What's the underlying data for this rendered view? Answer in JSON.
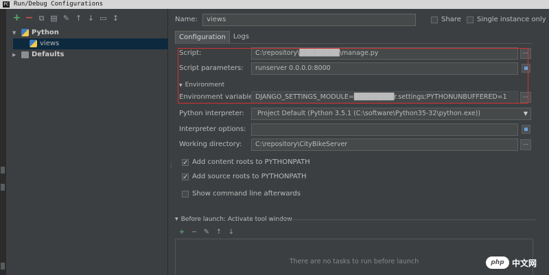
{
  "window": {
    "title": "Run/Debug Configurations",
    "app_icon": "PC"
  },
  "toolbar": {
    "buttons": [
      "+",
      "−",
      "⧉",
      "▤",
      "✎",
      "↑",
      "↓",
      "▭",
      "↕"
    ]
  },
  "tree": {
    "python": {
      "label": "Python",
      "arrow": "▼"
    },
    "views": {
      "label": "views"
    },
    "defaults": {
      "label": "Defaults",
      "arrow": "▶"
    }
  },
  "header": {
    "name_label": "Name:",
    "name_value": "views",
    "share_label": "Share",
    "single_instance_label": "Single instance only"
  },
  "tabs": [
    {
      "label": "Configuration",
      "active": true
    },
    {
      "label": "Logs",
      "active": false
    }
  ],
  "config": {
    "script_label": "Script:",
    "script_value": "C:\\repository\\████████\\manage.py",
    "script_params_label": "Script parameters:",
    "script_params_value": "runserver 0.0.0.0:8000",
    "environment_label": "Environment",
    "env_vars_label": "Environment variables:",
    "env_vars_value": "DJANGO_SETTINGS_MODULE=████████r.settings;PYTHONUNBUFFERED=1",
    "interpreter_label": "Python interpreter:",
    "interpreter_value": "Project Default (Python 3.5.1 (C:\\software\\Python35-32\\python.exe))",
    "interp_options_label": "Interpreter options:",
    "interp_options_value": "",
    "workdir_label": "Working directory:",
    "workdir_value": "C:\\repository\\CityBikeServer",
    "add_content_roots_label": "Add content roots to PYTHONPATH",
    "add_source_roots_label": "Add source roots to PYTHONPATH",
    "show_cmdline_label": "Show command line afterwards",
    "browse_label": "..."
  },
  "checkbox_states": {
    "share": false,
    "single_instance": false,
    "add_content_roots": true,
    "add_source_roots": true,
    "show_cmdline": false
  },
  "before_launch": {
    "header": "Before launch: Activate tool window",
    "buttons": [
      "+",
      "−",
      "✎",
      "↑",
      "↓"
    ],
    "empty_text": "There are no tasks to run before launch"
  },
  "watermark": {
    "logo": "php",
    "text": "中文网"
  },
  "colors": {
    "background": "#3c3f41",
    "field": "#45494a",
    "selection": "#0d293e",
    "highlight_box": "#d43030",
    "add_green": "#59a869",
    "remove_red": "#c75450"
  }
}
